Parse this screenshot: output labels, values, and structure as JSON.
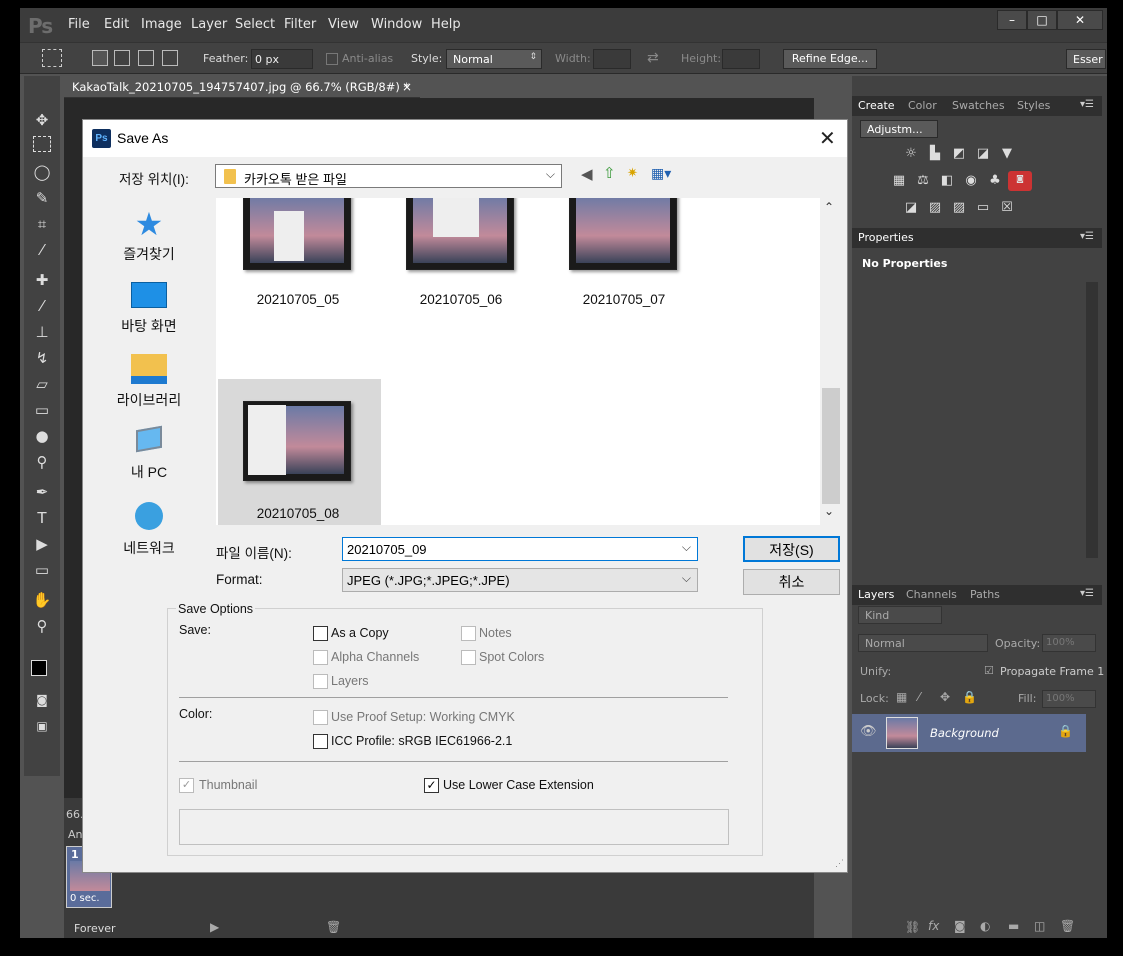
{
  "app": {
    "logo": "Ps",
    "menus": [
      "File",
      "Edit",
      "Image",
      "Layer",
      "Select",
      "Filter",
      "View",
      "Window",
      "Help"
    ],
    "window_controls": {
      "minimize": "–",
      "maximize": "□",
      "close": "✕"
    }
  },
  "options_bar": {
    "feather_label": "Feather:",
    "feather_value": "0 px",
    "antialias_label": "Anti-alias",
    "style_label": "Style:",
    "style_value": "Normal",
    "width_label": "Width:",
    "height_label": "Height:",
    "refine_edge": "Refine Edge...",
    "workspace": "Esser"
  },
  "document": {
    "tab_title": "KakaoTalk_20210705_194757407.jpg @ 66.7% (RGB/8#) *",
    "tab_close": "×",
    "zoom": "66.",
    "timeline_label": "An",
    "frame_number": "1",
    "frame_delay": "0 sec.",
    "loop": "Forever"
  },
  "right_panels": {
    "top_tabs": [
      "Create",
      "Color",
      "Swatches",
      "Styles"
    ],
    "adjustments_dropdown": "Adjustm...",
    "properties_tab": "Properties",
    "no_properties": "No Properties",
    "layers_tabs": [
      "Layers",
      "Channels",
      "Paths"
    ],
    "kind_label": "Kind",
    "blend_mode": "Normal",
    "opacity_label": "Opacity:",
    "opacity_value": "100%",
    "unify_label": "Unify:",
    "propagate": "Propagate Frame 1",
    "lock_label": "Lock:",
    "fill_label": "Fill:",
    "fill_value": "100%",
    "layer_name": "Background"
  },
  "dialog": {
    "title": "Save As",
    "save_in_label": "저장 위치(I):",
    "save_in_value": "카카오톡 받은 파일",
    "places": [
      "즐겨찾기",
      "바탕 화면",
      "라이브러리",
      "내 PC",
      "네트워크"
    ],
    "files": [
      "20210705_05",
      "20210705_06",
      "20210705_07",
      "20210705_08"
    ],
    "filename_label": "파일 이름(N):",
    "filename_value": "20210705_09",
    "format_label": "Format:",
    "format_value": "JPEG (*.JPG;*.JPEG;*.JPE)",
    "save_button": "저장(S)",
    "cancel_button": "취소",
    "save_options_title": "Save Options",
    "save_label": "Save:",
    "as_a_copy": "As a Copy",
    "notes": "Notes",
    "alpha_channels": "Alpha Channels",
    "spot_colors": "Spot Colors",
    "layers": "Layers",
    "color_label": "Color:",
    "use_proof_setup": "Use Proof Setup:  Working CMYK",
    "icc_profile": "ICC Profile:  sRGB IEC61966-2.1",
    "thumbnail": "Thumbnail",
    "lower_case_ext": "Use Lower Case Extension",
    "thumbnail_checked": true,
    "lower_case_checked": true
  }
}
